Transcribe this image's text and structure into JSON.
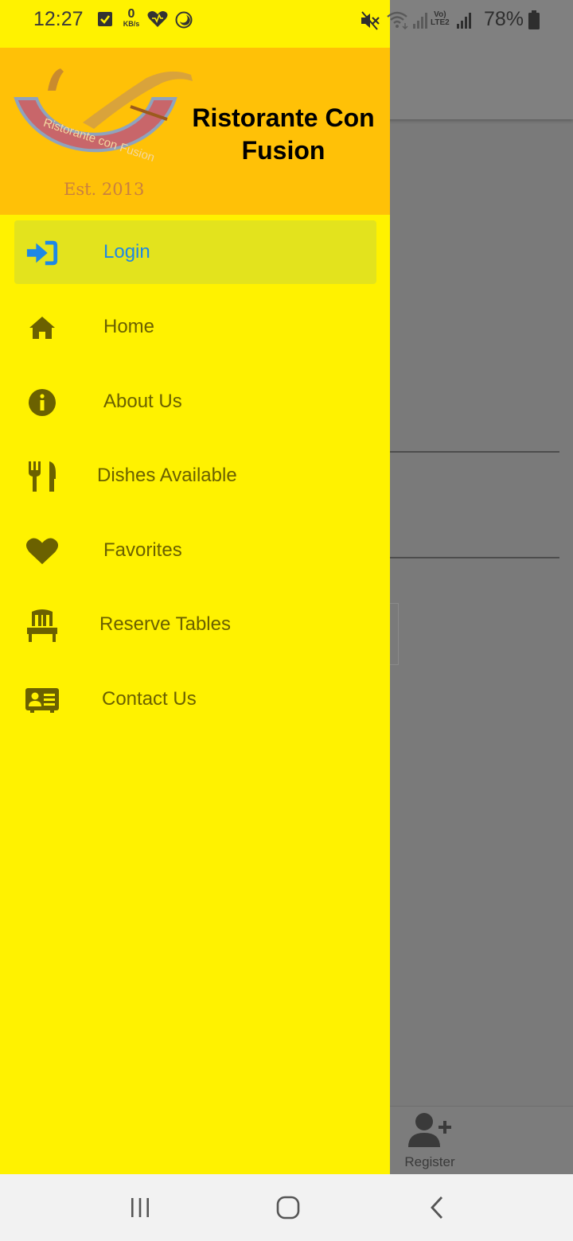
{
  "status_bar": {
    "time": "12:27",
    "net_speed_value": "0",
    "net_speed_unit": "KB/s",
    "lte_label_top": "Vo)",
    "lte_label_bottom": "LTE2",
    "battery": "78%"
  },
  "drawer": {
    "title": "Ristorante Con Fusion",
    "logo_text": "Ristorante con Fusion",
    "logo_est": "Est. 2013",
    "items": [
      {
        "label": "Login",
        "icon": "login-icon",
        "active": true
      },
      {
        "label": "Home",
        "icon": "home-icon"
      },
      {
        "label": "About Us",
        "icon": "info-icon"
      },
      {
        "label": "Dishes Available",
        "icon": "utensils-icon"
      },
      {
        "label": "Favorites",
        "icon": "heart-icon"
      },
      {
        "label": "Reserve Tables",
        "icon": "chair-icon"
      },
      {
        "label": "Contact Us",
        "icon": "address-card-icon"
      }
    ]
  },
  "tab_bar": {
    "register_label": "Register"
  },
  "colors": {
    "drawer_bg": "#fff200",
    "drawer_header_bg": "#ffc107",
    "active_item_bg": "#e3e31d",
    "active_text": "#1e88e5",
    "item_text": "#6b6100"
  }
}
